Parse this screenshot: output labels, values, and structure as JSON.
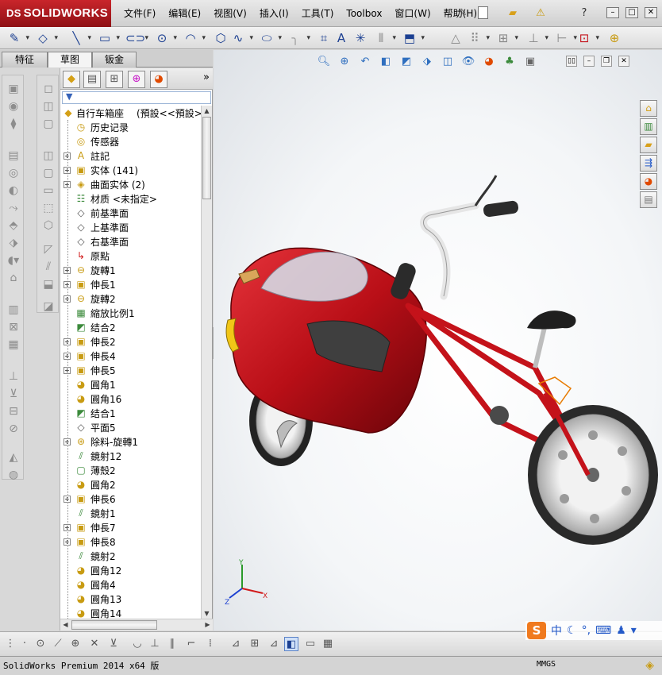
{
  "app": {
    "logo_text": "SOLIDWORKS",
    "logo_ds": "DS",
    "menu": [
      "文件(F)",
      "编辑(E)",
      "视图(V)",
      "插入(I)",
      "工具(T)",
      "Toolbox",
      "窗口(W)",
      "帮助(H)"
    ]
  },
  "tabs": [
    "特征",
    "草图",
    "钣金"
  ],
  "active_tab": "草图",
  "feature_tree": {
    "filter_icon": "▼",
    "root": {
      "label": "自行车箱座",
      "config": "(預設<<預設>_顯"
    },
    "items": [
      {
        "label": "历史记录",
        "icon": "history-icon",
        "expandable": false
      },
      {
        "label": "传感器",
        "icon": "sensor-icon",
        "expandable": false
      },
      {
        "label": "註記",
        "icon": "annotation-icon",
        "expandable": true
      },
      {
        "label": "实体 (141)",
        "icon": "solid-bodies-icon",
        "expandable": true
      },
      {
        "label": "曲面实体 (2)",
        "icon": "surface-bodies-icon",
        "expandable": true
      },
      {
        "label": "材质 <未指定>",
        "icon": "material-icon",
        "expandable": false
      },
      {
        "label": "前基準面",
        "icon": "plane-icon",
        "expandable": false
      },
      {
        "label": "上基準面",
        "icon": "plane-icon",
        "expandable": false
      },
      {
        "label": "右基準面",
        "icon": "plane-icon",
        "expandable": false
      },
      {
        "label": "原點",
        "icon": "origin-icon",
        "expandable": false
      },
      {
        "label": "旋轉1",
        "icon": "revolve-icon",
        "expandable": true
      },
      {
        "label": "伸長1",
        "icon": "extrude-icon",
        "expandable": true
      },
      {
        "label": "旋轉2",
        "icon": "revolve-icon",
        "expandable": true
      },
      {
        "label": "縮放比例1",
        "icon": "scale-icon",
        "expandable": false
      },
      {
        "label": "结合2",
        "icon": "combine-icon",
        "expandable": false
      },
      {
        "label": "伸長2",
        "icon": "extrude-icon",
        "expandable": true
      },
      {
        "label": "伸長4",
        "icon": "extrude-icon",
        "expandable": true
      },
      {
        "label": "伸長5",
        "icon": "extrude-icon",
        "expandable": true
      },
      {
        "label": "圓角1",
        "icon": "fillet-icon",
        "expandable": false
      },
      {
        "label": "圓角16",
        "icon": "fillet-icon",
        "expandable": false
      },
      {
        "label": "结合1",
        "icon": "combine-icon",
        "expandable": false
      },
      {
        "label": "平面5",
        "icon": "plane-icon",
        "expandable": false
      },
      {
        "label": "除料-旋轉1",
        "icon": "cut-revolve-icon",
        "expandable": true
      },
      {
        "label": "鏡射12",
        "icon": "mirror-icon",
        "expandable": false
      },
      {
        "label": "薄殼2",
        "icon": "shell-icon",
        "expandable": false
      },
      {
        "label": "圓角2",
        "icon": "fillet-icon",
        "expandable": false
      },
      {
        "label": "伸長6",
        "icon": "extrude-icon",
        "expandable": true
      },
      {
        "label": "鏡射1",
        "icon": "mirror-icon",
        "expandable": false
      },
      {
        "label": "伸長7",
        "icon": "extrude-icon",
        "expandable": true
      },
      {
        "label": "伸長8",
        "icon": "extrude-icon",
        "expandable": true
      },
      {
        "label": "鏡射2",
        "icon": "mirror-icon",
        "expandable": false
      },
      {
        "label": "圓角12",
        "icon": "fillet-icon",
        "expandable": false
      },
      {
        "label": "圓角4",
        "icon": "fillet-icon",
        "expandable": false
      },
      {
        "label": "圓角13",
        "icon": "fillet-icon",
        "expandable": false
      },
      {
        "label": "圓角14",
        "icon": "fillet-icon",
        "expandable": false
      }
    ]
  },
  "ime": {
    "logo": "S",
    "mode": "中"
  },
  "status": {
    "text": "SolidWorks Premium 2014 x64 版",
    "units": "MMGS"
  },
  "triad": {
    "x": "X",
    "y": "Y",
    "z": "Z"
  },
  "colors": {
    "accent": "#1b3f91",
    "model_red": "#c4121a",
    "brand_red": "#b81c22"
  }
}
